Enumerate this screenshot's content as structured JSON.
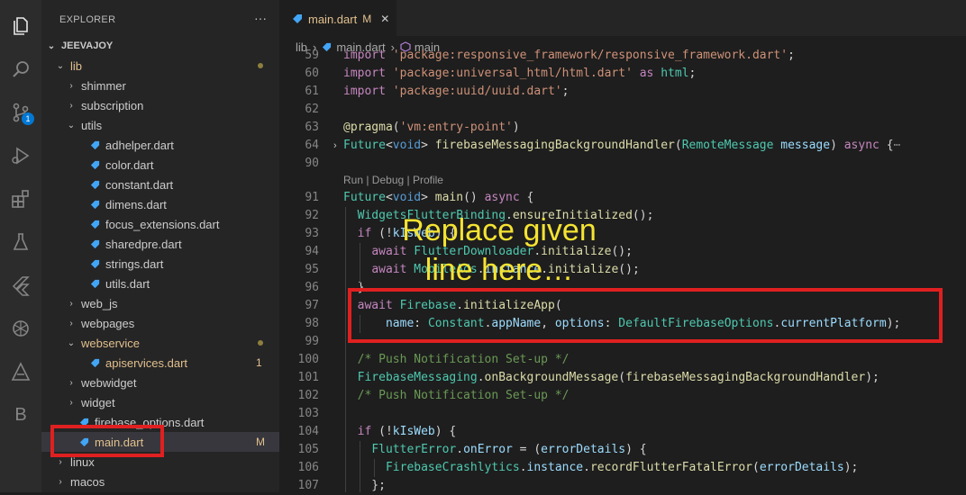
{
  "activity_bar": {
    "icons": [
      "explorer-icon",
      "search-icon",
      "source-control-icon",
      "run-debug-icon",
      "extensions-icon",
      "testing-icon",
      "flutter-icon",
      "chatgpt-icon",
      "a-icon",
      "b-icon"
    ],
    "scm_badge": "1",
    "b_label": "B"
  },
  "sidebar": {
    "title": "EXPLORER",
    "more": "···",
    "root": "JEEVAJOY",
    "items": [
      {
        "label": "lib",
        "type": "folder-open",
        "depth": 1,
        "color": "#e2c08d",
        "dot": true
      },
      {
        "label": "shimmer",
        "type": "folder",
        "depth": 2
      },
      {
        "label": "subscription",
        "type": "folder",
        "depth": 2
      },
      {
        "label": "utils",
        "type": "folder-open",
        "depth": 2
      },
      {
        "label": "adhelper.dart",
        "type": "file",
        "depth": 3
      },
      {
        "label": "color.dart",
        "type": "file",
        "depth": 3
      },
      {
        "label": "constant.dart",
        "type": "file",
        "depth": 3
      },
      {
        "label": "dimens.dart",
        "type": "file",
        "depth": 3
      },
      {
        "label": "focus_extensions.dart",
        "type": "file",
        "depth": 3
      },
      {
        "label": "sharedpre.dart",
        "type": "file",
        "depth": 3
      },
      {
        "label": "strings.dart",
        "type": "file",
        "depth": 3
      },
      {
        "label": "utils.dart",
        "type": "file",
        "depth": 3
      },
      {
        "label": "web_js",
        "type": "folder",
        "depth": 2
      },
      {
        "label": "webpages",
        "type": "folder",
        "depth": 2
      },
      {
        "label": "webservice",
        "type": "folder-open",
        "depth": 2,
        "color": "#e2c08d",
        "dot": true
      },
      {
        "label": "apiservices.dart",
        "type": "file",
        "depth": 3,
        "color": "#e2c08d",
        "status": "1"
      },
      {
        "label": "webwidget",
        "type": "folder",
        "depth": 2
      },
      {
        "label": "widget",
        "type": "folder",
        "depth": 2
      },
      {
        "label": "firebase_options.dart",
        "type": "file",
        "depth": 2
      },
      {
        "label": "main.dart",
        "type": "file",
        "depth": 2,
        "color": "#e2c08d",
        "status": "M",
        "selected": true
      },
      {
        "label": "linux",
        "type": "folder",
        "depth": 1
      },
      {
        "label": "macos",
        "type": "folder",
        "depth": 1
      }
    ]
  },
  "tab": {
    "label": "main.dart",
    "status": "M",
    "close": "✕"
  },
  "breadcrumb": {
    "part1": "lib",
    "sep": "›",
    "part2": "main.dart",
    "part3": "main"
  },
  "codelens": "Run | Debug | Profile",
  "code_lines": [
    {
      "n": "59",
      "html": "<span class='c'>import</span> <span class='s'>'package:responsive_framework/responsive_framework.dart'</span>;"
    },
    {
      "n": "60",
      "html": "<span class='c'>import</span> <span class='s'>'package:universal_html/html.dart'</span> <span class='c'>as</span> <span class='t'>html</span>;"
    },
    {
      "n": "61",
      "html": "<span class='c'>import</span> <span class='s'>'package:uuid/uuid.dart'</span>;"
    },
    {
      "n": "62",
      "html": ""
    },
    {
      "n": "63",
      "html": "<span class='f'>@pragma</span>(<span class='s'>'vm:entry-point'</span>)"
    },
    {
      "n": "64",
      "html": "<span class='t'>Future</span>&lt;<span class='k'>void</span>&gt; <span class='f'>firebaseMessagingBackgroundHandler</span>(<span class='t'>RemoteMessage</span> <span class='v'>message</span>) <span class='c'>async</span> {<span style='color:#888'>⋯</span>"
    },
    {
      "n": "90",
      "html": ""
    },
    {
      "n": "91",
      "html": "<span class='t'>Future</span>&lt;<span class='k'>void</span>&gt; <span class='f'>main</span>() <span class='c'>async</span> {"
    },
    {
      "n": "92",
      "html": "  <span class='t'>WidgetsFlutterBinding</span>.<span class='f'>ensureInitialized</span>();"
    },
    {
      "n": "93",
      "html": "  <span class='c'>if</span> (!<span class='v'>kIsWeb</span>) {"
    },
    {
      "n": "94",
      "html": "    <span class='c'>await</span> <span class='t'>FlutterDownloader</span>.<span class='f'>initialize</span>();"
    },
    {
      "n": "95",
      "html": "    <span class='c'>await</span> <span class='t'>MobileAds</span>.<span class='v'>instance</span>.<span class='f'>initialize</span>();"
    },
    {
      "n": "96",
      "html": "  }"
    },
    {
      "n": "97",
      "html": "  <span class='c'>await</span> <span class='t'>Firebase</span>.<span class='f'>initializeApp</span>("
    },
    {
      "n": "98",
      "html": "      <span class='v'>name</span>: <span class='t'>Constant</span>.<span class='v'>appName</span>, <span class='v'>options</span>: <span class='t'>DefaultFirebaseOptions</span>.<span class='v'>currentPlatform</span>);"
    },
    {
      "n": "99",
      "html": ""
    },
    {
      "n": "100",
      "html": "  <span class='cm'>/* Push Notification Set-up */</span>"
    },
    {
      "n": "101",
      "html": "  <span class='t'>FirebaseMessaging</span>.<span class='f'>onBackgroundMessage</span>(<span class='f'>firebaseMessagingBackgroundHandler</span>);"
    },
    {
      "n": "102",
      "html": "  <span class='cm'>/* Push Notification Set-up */</span>"
    },
    {
      "n": "103",
      "html": ""
    },
    {
      "n": "104",
      "html": "  <span class='c'>if</span> (!<span class='v'>kIsWeb</span>) {"
    },
    {
      "n": "105",
      "html": "    <span class='t'>FlutterError</span>.<span class='v'>onError</span> = (<span class='v'>errorDetails</span>) {"
    },
    {
      "n": "106",
      "html": "      <span class='t'>FirebaseCrashlytics</span>.<span class='v'>instance</span>.<span class='f'>recordFlutterFatalError</span>(<span class='v'>errorDetails</span>);"
    },
    {
      "n": "107",
      "html": "    };"
    }
  ],
  "annotation": {
    "line1": "Replace given",
    "line2": "line here…"
  },
  "colors": {
    "annotation": "#f5e332",
    "highlight": "#e02020",
    "dart": "#42a5f5"
  }
}
